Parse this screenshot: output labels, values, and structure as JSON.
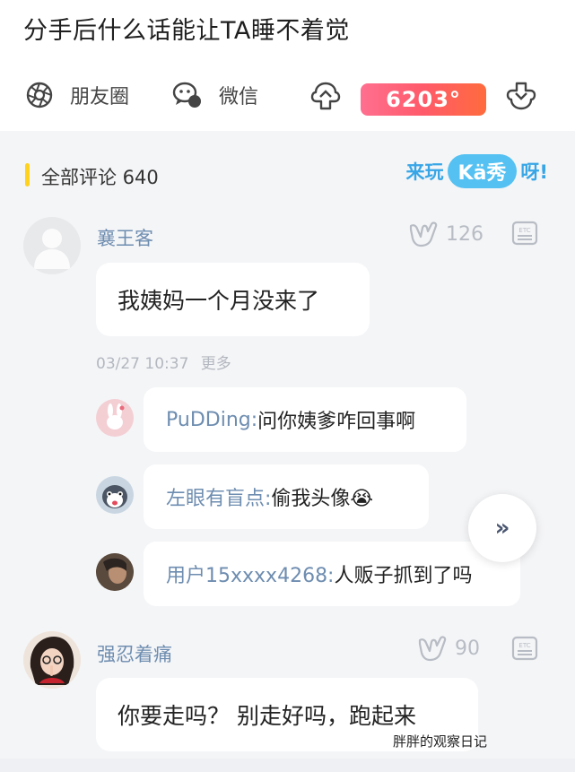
{
  "title": "分手后什么话能让TA睡不着觉",
  "share": {
    "moments_label": "朋友圈",
    "wechat_label": "微信",
    "score": "6203°"
  },
  "comments_header": {
    "label": "全部评论 640",
    "promo_prefix": "来玩",
    "promo_brand": "Kä秀",
    "promo_suffix": "呀!"
  },
  "comments": [
    {
      "username": "襄王客",
      "likes": "126",
      "text": "我姨妈一个月没来了",
      "timestamp": "03/27 10:37",
      "more": "更多",
      "replies": [
        {
          "name": "PuDDing:",
          "text": " 问你姨爹咋回事啊"
        },
        {
          "name": "左眼有盲点:",
          "text": " 偷我头像😭"
        },
        {
          "name": "用户15xxxx4268:",
          "text": " 人贩子抓到了吗"
        }
      ]
    },
    {
      "username": "强忍着痛",
      "likes": "90",
      "text": "你要走吗？ 别走好吗，跑起来"
    }
  ],
  "watermark": "胖胖的观察日记",
  "colors": {
    "accent_yellow": "#ffd21e",
    "username_blue": "#6e8db0",
    "score_gradient_start": "#ff6f8f",
    "score_gradient_end": "#ff6b3d",
    "promo_blue": "#54c1f2"
  }
}
